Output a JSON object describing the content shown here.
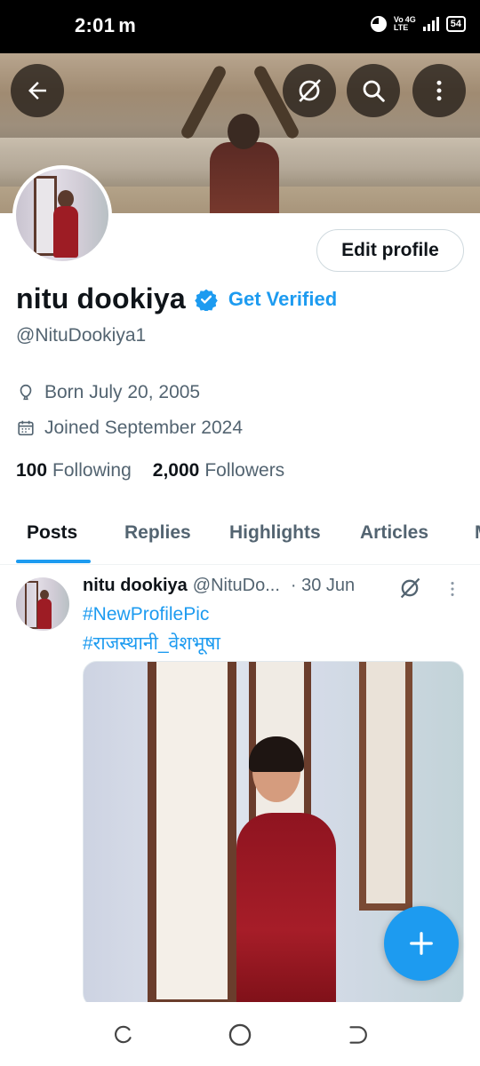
{
  "status_bar": {
    "time": "2:01",
    "carrier_icon": "m",
    "network": "Vo LTE 4G",
    "network_line1": "Vo",
    "network_line2": "LTE",
    "network_gen": "4G",
    "battery": "54"
  },
  "header": {
    "back_icon": "arrow-left-icon",
    "grok_icon": "slash-circle-icon",
    "search_icon": "search-icon",
    "more_icon": "more-vertical-icon"
  },
  "profile": {
    "name": "nitu dookiya",
    "verified_icon": "verified-badge-icon",
    "get_verified_label": "Get Verified",
    "handle": "@NituDookiya1",
    "edit_button_label": "Edit profile",
    "born": "Born July 20, 2005",
    "joined": "Joined September 2024",
    "following_count": "100",
    "following_label": "Following",
    "followers_count": "2,000",
    "followers_label": "Followers"
  },
  "tabs": [
    {
      "label": "Posts",
      "active": true
    },
    {
      "label": "Replies",
      "active": false
    },
    {
      "label": "Highlights",
      "active": false
    },
    {
      "label": "Articles",
      "active": false
    },
    {
      "label": "M",
      "active": false
    }
  ],
  "post": {
    "author_name": "nitu dookiya",
    "author_handle": "@NituDo...",
    "date": "· 30 Jun",
    "lines": [
      "#NewProfilePic",
      "#राजस्थानी_वेशभूषा"
    ]
  },
  "colors": {
    "accent": "#1d9bf0",
    "text_primary": "#0f1419",
    "text_secondary": "#536471"
  },
  "fab_icon": "plus-icon",
  "navbar": {
    "recents_icon": "recents-icon",
    "home_icon": "home-circle-icon",
    "back_icon": "back-icon"
  }
}
